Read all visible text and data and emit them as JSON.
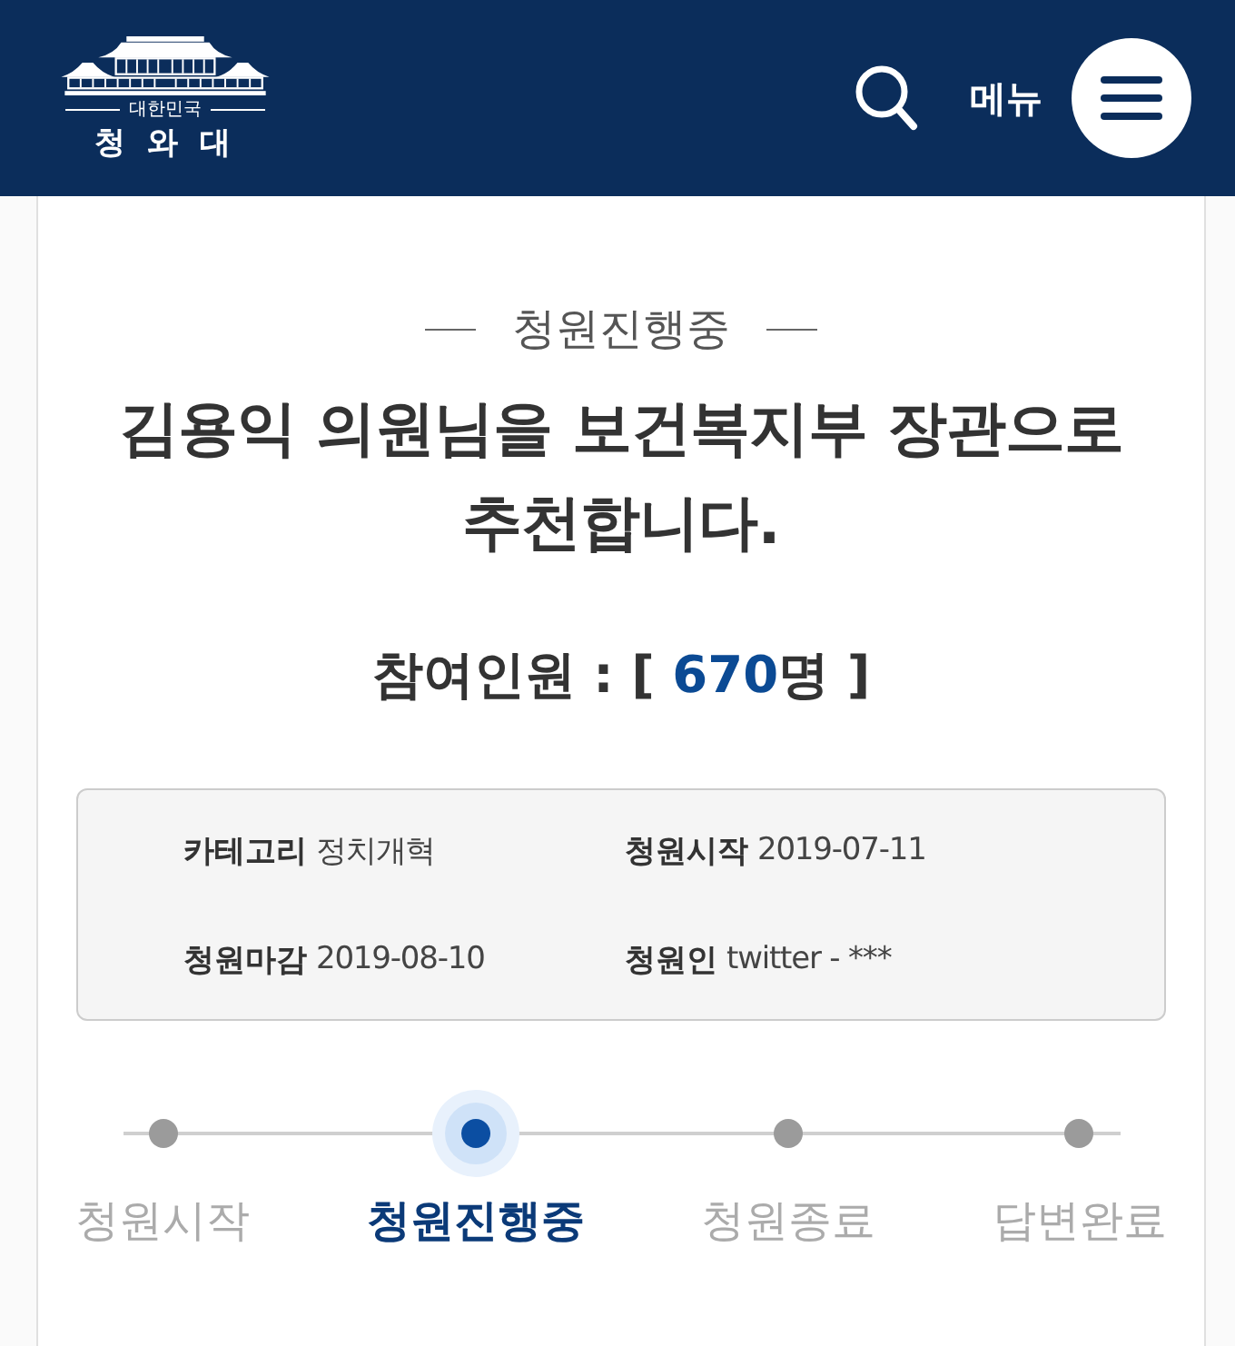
{
  "header": {
    "logo": {
      "country": "대한민국",
      "name": "청 와 대"
    },
    "menu_label": "메뉴"
  },
  "petition": {
    "status": "청원진행중",
    "title": "김용익 의원님을 보건복지부 장관으로 추천합니다.",
    "participants": {
      "label": "참여인원 : [",
      "count": "670",
      "unit": "명 ]"
    }
  },
  "details": [
    {
      "label": "카테고리",
      "value": "정치개혁"
    },
    {
      "label": "청원시작",
      "value": "2019-07-11"
    },
    {
      "label": "청원마감",
      "value": "2019-08-10"
    },
    {
      "label": "청원인",
      "value": "twitter - ***"
    }
  ],
  "steps": [
    {
      "label": "청원시작",
      "selected": false
    },
    {
      "label": "청원진행중",
      "selected": true
    },
    {
      "label": "청원종료",
      "selected": false
    },
    {
      "label": "답변완료",
      "selected": false
    }
  ]
}
